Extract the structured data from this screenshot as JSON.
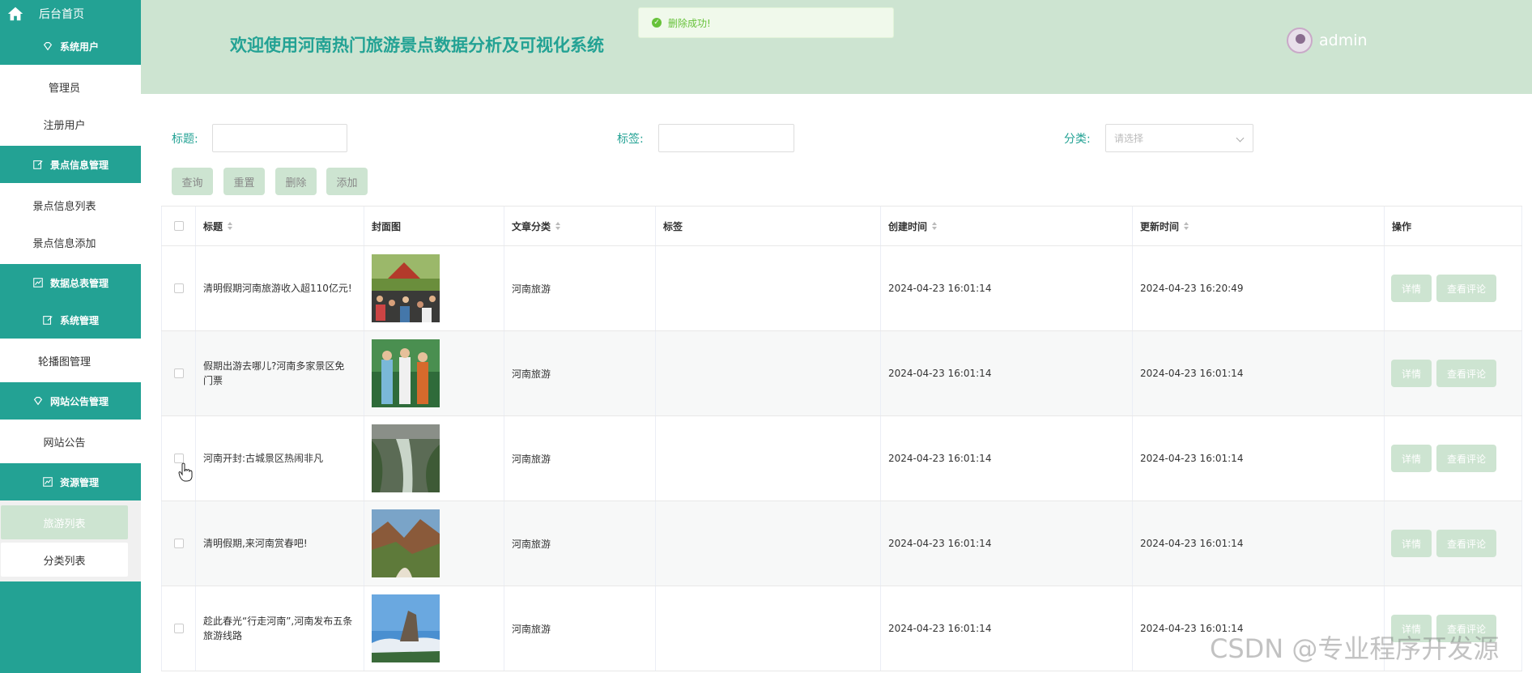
{
  "sidebar": {
    "home_label": "后台首页",
    "groups": {
      "system_users": "系统用户",
      "spot_info": "景点信息管理",
      "data_summary": "数据总表管理",
      "system_mgmt": "系统管理",
      "notice_mgmt": "网站公告管理",
      "resource_mgmt": "资源管理"
    },
    "items": {
      "admin": "管理员",
      "registered": "注册用户",
      "spot_list": "景点信息列表",
      "spot_add": "景点信息添加",
      "carousel": "轮播图管理",
      "notice": "网站公告",
      "travel_list": "旅游列表",
      "category_list": "分类列表"
    }
  },
  "header": {
    "title": "欢迎使用河南热门旅游景点数据分析及可视化系统",
    "username": "admin"
  },
  "toast": {
    "message": "删除成功!"
  },
  "search": {
    "title_label": "标题:",
    "tag_label": "标签:",
    "category_label": "分类:",
    "category_placeholder": "请选择",
    "title_value": "",
    "tag_value": ""
  },
  "buttons": {
    "query": "查询",
    "reset": "重置",
    "delete": "删除",
    "add": "添加"
  },
  "table": {
    "headers": {
      "title": "标题",
      "cover": "封面图",
      "category": "文章分类",
      "tag": "标签",
      "created": "创建时间",
      "updated": "更新时间",
      "actions": "操作"
    },
    "rows": [
      {
        "title": "清明假期河南旅游收入超110亿元!",
        "category": "河南旅游",
        "tag": "",
        "created": "2024-04-23 16:01:14",
        "updated": "2024-04-23 16:20:49"
      },
      {
        "title": "假期出游去哪儿?河南多家景区免门票",
        "category": "河南旅游",
        "tag": "",
        "created": "2024-04-23 16:01:14",
        "updated": "2024-04-23 16:01:14"
      },
      {
        "title": "河南开封:古城景区热闹非凡",
        "category": "河南旅游",
        "tag": "",
        "created": "2024-04-23 16:01:14",
        "updated": "2024-04-23 16:01:14"
      },
      {
        "title": "清明假期,来河南赏春吧!",
        "category": "河南旅游",
        "tag": "",
        "created": "2024-04-23 16:01:14",
        "updated": "2024-04-23 16:01:14"
      },
      {
        "title": "趁此春光“行走河南”,河南发布五条旅游线路",
        "category": "河南旅游",
        "tag": "",
        "created": "2024-04-23 16:01:14",
        "updated": "2024-04-23 16:01:14"
      }
    ],
    "row_actions": {
      "detail": "详情",
      "comments": "查看评论"
    }
  },
  "watermark": "CSDN @专业程序开发源",
  "colors": {
    "primary": "#23a294",
    "header_bg": "#cde4d1",
    "button_bg": "#cde4d1",
    "success": "#67c23a"
  }
}
